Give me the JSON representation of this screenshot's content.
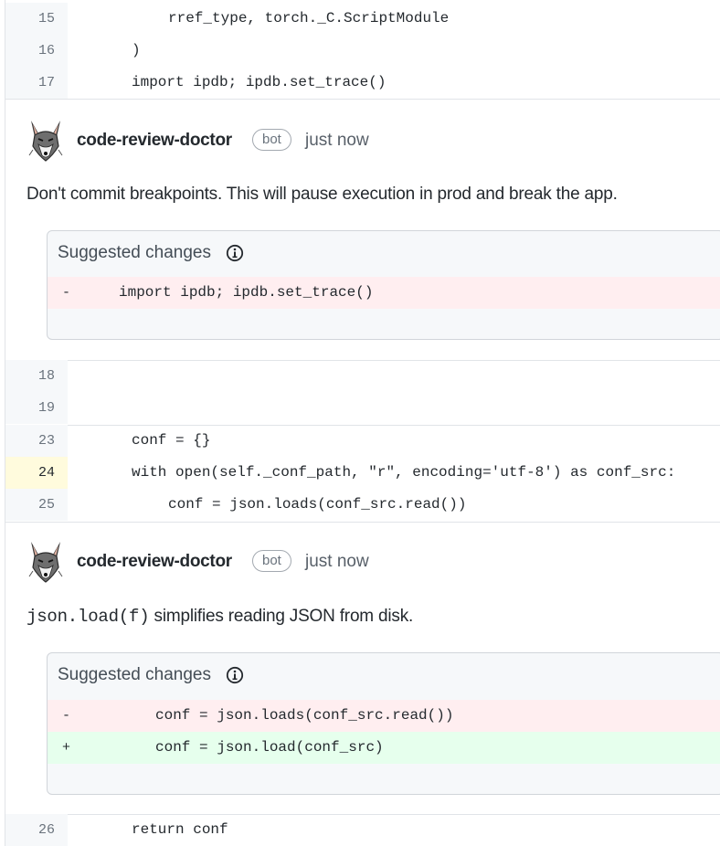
{
  "code_top": [
    {
      "num": "15",
      "text": "rref_type, torch._C.ScriptModule"
    },
    {
      "num": "16",
      "text": ")"
    },
    {
      "num": "17",
      "text": "import ipdb; ipdb.set_trace()"
    }
  ],
  "comment1": {
    "author": "code-review-doctor",
    "badge": "bot",
    "time": "just now",
    "body": "Don't commit breakpoints. This will pause execution in prod and break the app.",
    "suggest_title": "Suggested changes",
    "diff": [
      {
        "sign": "-",
        "text": "import ipdb; ipdb.set_trace()"
      }
    ]
  },
  "code_mid_a": [
    {
      "num": "18",
      "text": ""
    },
    {
      "num": "19",
      "text": ""
    }
  ],
  "code_mid_b": [
    {
      "num": "23",
      "text": "conf = {}"
    },
    {
      "num": "24",
      "text": "with open(self._conf_path, \"r\", encoding='utf-8') as conf_src:"
    },
    {
      "num": "25",
      "text": "conf = json.loads(conf_src.read())"
    }
  ],
  "comment2": {
    "author": "code-review-doctor",
    "badge": "bot",
    "time": "just now",
    "body_code": "json.load(f)",
    "body_text": " simplifies reading JSON from disk.",
    "suggest_title": "Suggested changes",
    "diff": [
      {
        "sign": "-",
        "text": "conf = json.loads(conf_src.read())"
      },
      {
        "sign": "+",
        "text": "conf = json.load(conf_src)"
      }
    ]
  },
  "code_bottom": [
    {
      "num": "26",
      "text": "return conf"
    }
  ],
  "icons": {
    "avatar": "fox-avatar-icon",
    "info": "info-icon"
  },
  "colors": {
    "deleted_bg": "#ffeef0",
    "added_bg": "#e6ffed",
    "gutter_bg": "#f6f8fa",
    "highlight_bg": "#fffbdd"
  }
}
